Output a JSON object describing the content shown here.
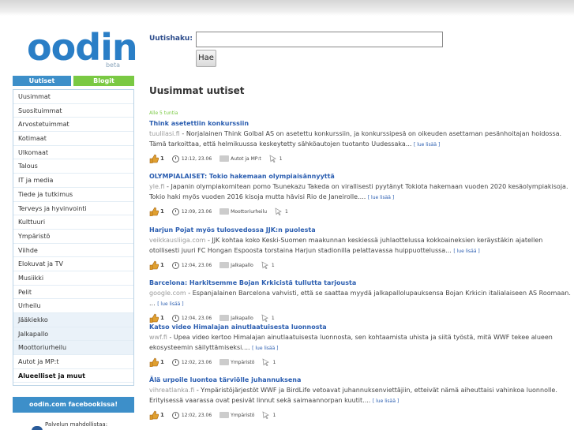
{
  "logo": {
    "text": "oodin",
    "tag": "beta"
  },
  "search": {
    "label": "Uutishaku:",
    "value": "",
    "button": "Hae"
  },
  "tabs": {
    "news": "Uutiset",
    "blogs": "Blogit"
  },
  "sidebar": {
    "items": [
      "Uusimmat",
      "Suosituimmat",
      "Arvostetuimmat",
      "Kotimaat",
      "Ulkomaat",
      "Talous",
      "IT ja media",
      "Tiede ja tutkimus",
      "Terveys ja hyvinvointi",
      "Kulttuuri",
      "Ympäristö",
      "Viihde",
      "Elokuvat ja TV",
      "Musiikki",
      "Pelit",
      "Urheilu",
      "Jääkiekko",
      "Jalkapallo",
      "Moottoriurheilu",
      "Autot ja MP:t",
      "Alueelliset ja muut"
    ]
  },
  "facebook_box": "oodin.com facebookissa!",
  "footer_note": "Palvelun mahdollistaa:",
  "main": {
    "title": "Uusimmat uutiset",
    "timeago": "Alle 5 tuntia",
    "read_more": "[ lue lisää ]",
    "articles": [
      {
        "title": "Think asetettiin konkurssiin",
        "source": "tuulilasi.fi",
        "text": "Norjalainen Think Golbal AS on asetettu konkurssiin, ja konkurssipesä on oikeuden asettaman pesänhoitajan hoidossa. Tämä tarkoittaa, että helmikuussa keskeytetty sähköautojen tuotanto Uudessaka...",
        "likes": "1",
        "time": "12:12, 23.06",
        "category": "Autot ja MP:t",
        "clicks": "1"
      },
      {
        "title": "OLYMPIALAISET: Tokio hakemaan olympiaisännyyttä",
        "source": "yle.fi",
        "text": "Japanin olympiakomitean pomo Tsunekazu Takeda on virallisesti pyytänyt Tokiota hakemaan vuoden 2020 kesäolympiakisoja. Tokio haki myös vuoden 2016 kisoja mutta hävisi Rio de Janeirolle....",
        "likes": "1",
        "time": "12:09, 23.06",
        "category": "Moottoriurheilu",
        "clicks": "1"
      },
      {
        "title": "Harjun Pojat myös tulosvedossa JJK:n puolesta",
        "source": "veikkausliiga.com",
        "text": "JJK kohtaa koko Keski-Suomen maakunnan keskiessä juhlaottelussa kokkoaineksien keräystäkin ajatellen otollisesti juuri FC Hongan Espoosta torstaina Harjun stadionilla pelattavassa huippuottelussa...",
        "likes": "1",
        "time": "12:04, 23.06",
        "category": "Jalkapallo",
        "clicks": "1"
      },
      {
        "title": "Barcelona: Harkitsemme Bojan Krkicistä tullutta tarjousta",
        "source": "google.com",
        "text": "Espanjalainen Barcelona vahvisti, että se saattaa myydä jalkapallolupauksensa Bojan Krkicin italialaiseen AS Roomaan. ...",
        "likes": "1",
        "time": "12:04, 23.06",
        "category": "Jalkapallo",
        "clicks": "1"
      },
      {
        "title": "Katso video Himalajan ainutlaatuisesta luonnosta",
        "source": "wwf.fi",
        "text": "Upea video kertoo Himalajan ainutlaatuisesta luonnosta, sen kohtaamista uhista ja siitä työstä, mitä WWF tekee alueen ekosysteemin säilyttämiseksi....",
        "likes": "1",
        "time": "12:02, 23.06",
        "category": "Ympäristö",
        "clicks": "1"
      },
      {
        "title": "Älä urpoile luontoa tärviölle juhannuksena",
        "source": "vihreatlanka.fi",
        "text": "Ympäristöjärjestöt WWF ja BirdLife vetoavat juhannuksenviettäjiin, etteivät nämä aiheuttaisi vahinkoa luonnolle. Erityisessä vaarassa ovat pesivät linnut sekä saimaannorpan kuutit....",
        "likes": "1",
        "time": "12:02, 23.06",
        "category": "Ympäristö",
        "clicks": "1"
      }
    ]
  },
  "colors": {
    "brand_blue": "#2a7ec6",
    "tab_blue": "#3d8fc9",
    "tab_green": "#7ac943",
    "link_blue": "#2a5db0"
  }
}
